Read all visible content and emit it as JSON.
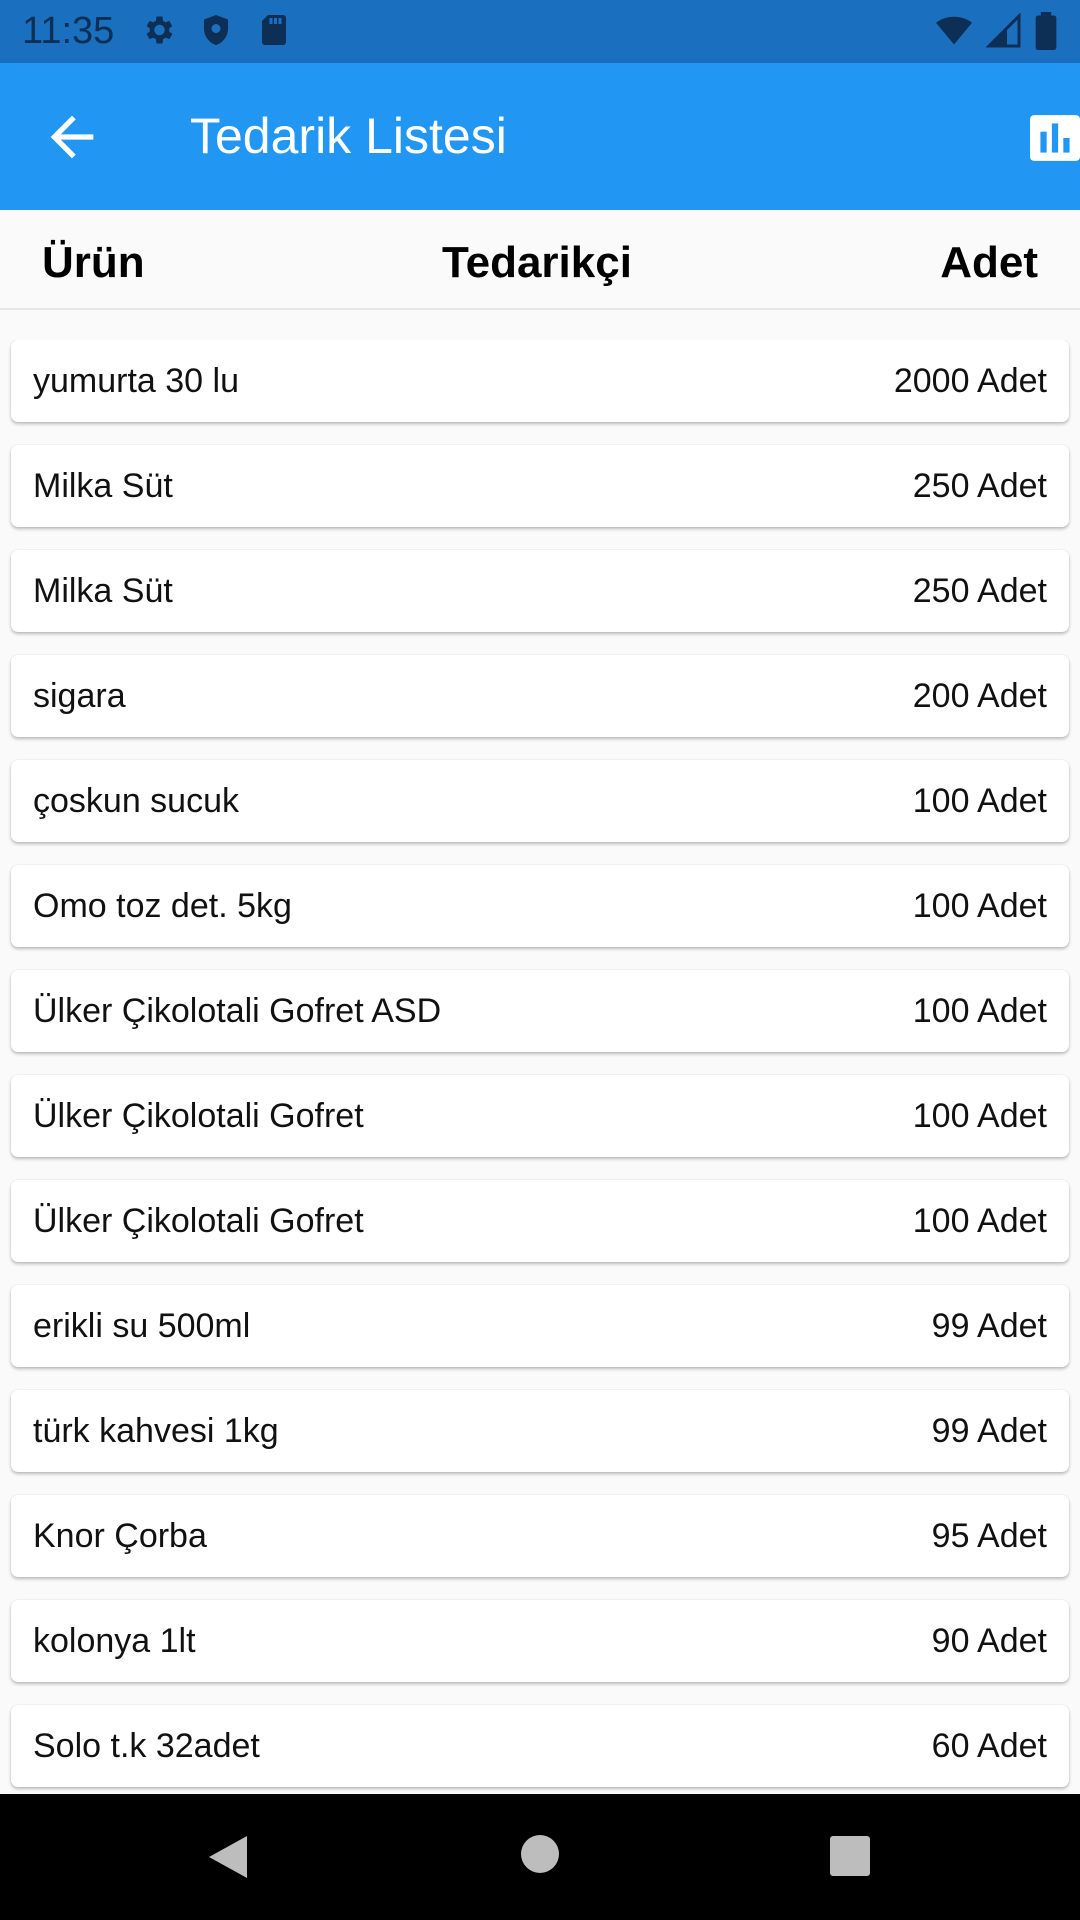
{
  "status_bar": {
    "time": "11:35",
    "left_icons": [
      "gear-icon",
      "shield-icon",
      "sd-card-icon"
    ],
    "right_icons": [
      "wifi-icon",
      "signal-icon",
      "battery-icon"
    ]
  },
  "app_bar": {
    "title": "Tedarik Listesi",
    "back_icon": "arrow-back-icon",
    "action_icon": "bar-chart-icon",
    "color": "#2196f3"
  },
  "columns": {
    "product": "Ürün",
    "supplier": "Tedarikçi",
    "quantity": "Adet"
  },
  "rows": [
    {
      "name": "yumurta 30 lu",
      "qty": "2000 Adet"
    },
    {
      "name": "Milka Süt",
      "qty": "250 Adet"
    },
    {
      "name": "Milka Süt",
      "qty": "250 Adet"
    },
    {
      "name": "sigara",
      "qty": "200 Adet"
    },
    {
      "name": "çoskun sucuk",
      "qty": "100 Adet"
    },
    {
      "name": "Omo toz det. 5kg",
      "qty": "100 Adet"
    },
    {
      "name": "Ülker Çikolotali Gofret ASD",
      "qty": "100 Adet"
    },
    {
      "name": "Ülker Çikolotali Gofret",
      "qty": "100 Adet"
    },
    {
      "name": "Ülker Çikolotali Gofret",
      "qty": "100 Adet"
    },
    {
      "name": "erikli su 500ml",
      "qty": "99 Adet"
    },
    {
      "name": "türk kahvesi 1kg",
      "qty": "99 Adet"
    },
    {
      "name": "Knor Çorba",
      "qty": "95 Adet"
    },
    {
      "name": "kolonya 1lt",
      "qty": "90 Adet"
    },
    {
      "name": "Solo t.k 32adet",
      "qty": "60 Adet"
    }
  ],
  "nav_bar": {
    "icons": [
      "nav-back-icon",
      "nav-home-icon",
      "nav-recents-icon"
    ]
  }
}
